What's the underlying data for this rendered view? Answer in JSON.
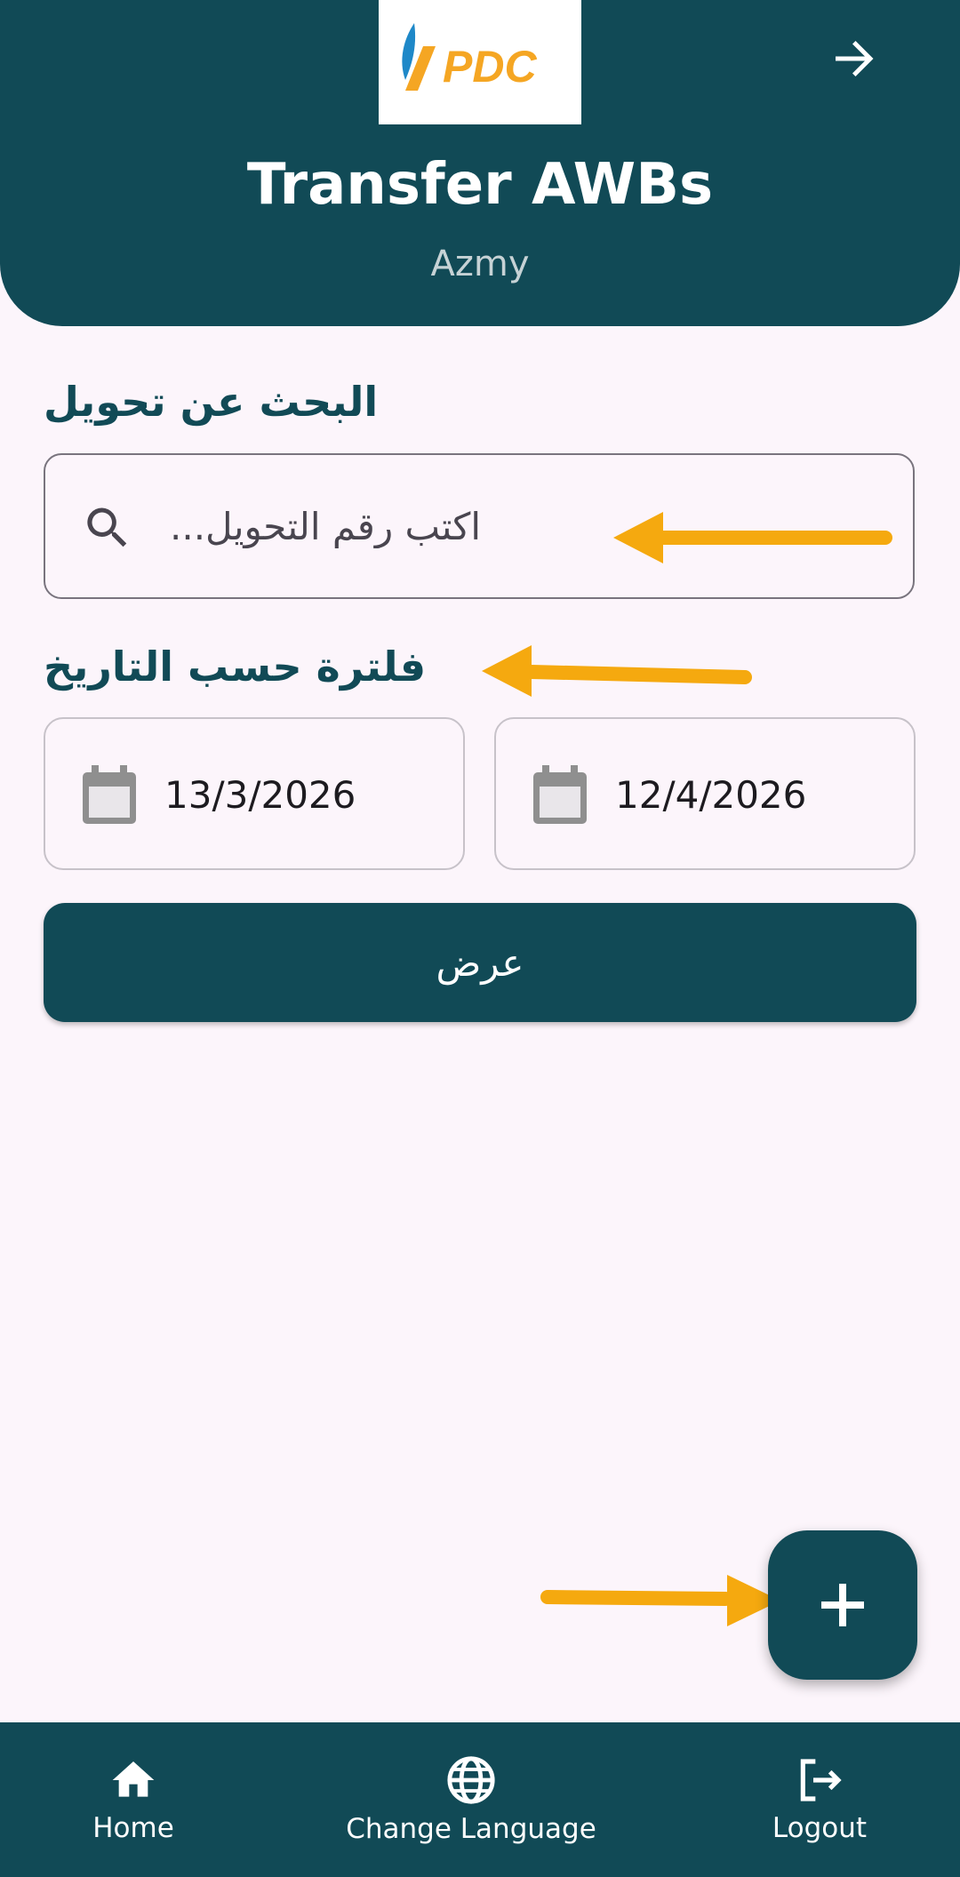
{
  "header": {
    "logo_text": "PDC",
    "title": "Transfer AWBs",
    "subtitle": "Azmy",
    "back_icon": "arrow-right-icon"
  },
  "search": {
    "label": "البحث عن تحويل",
    "placeholder": "اكتب رقم التحويل...",
    "icon": "search-icon"
  },
  "filter": {
    "label": "فلترة حسب التاريخ",
    "from_date": "13/3/2026",
    "to_date": "12/4/2026",
    "icon": "calendar-icon"
  },
  "show_button": {
    "label": "عرض"
  },
  "fab": {
    "icon": "plus-icon"
  },
  "bottom_nav": {
    "items": [
      {
        "label": "Home",
        "icon": "home-icon"
      },
      {
        "label": "Change Language",
        "icon": "globe-icon"
      },
      {
        "label": "Logout",
        "icon": "logout-icon"
      }
    ]
  },
  "colors": {
    "primary": "#114a56",
    "background": "#fcf5fb",
    "annotation_arrow": "#f5a90f",
    "logo_blue": "#1e88c8",
    "logo_orange": "#f5a623"
  }
}
